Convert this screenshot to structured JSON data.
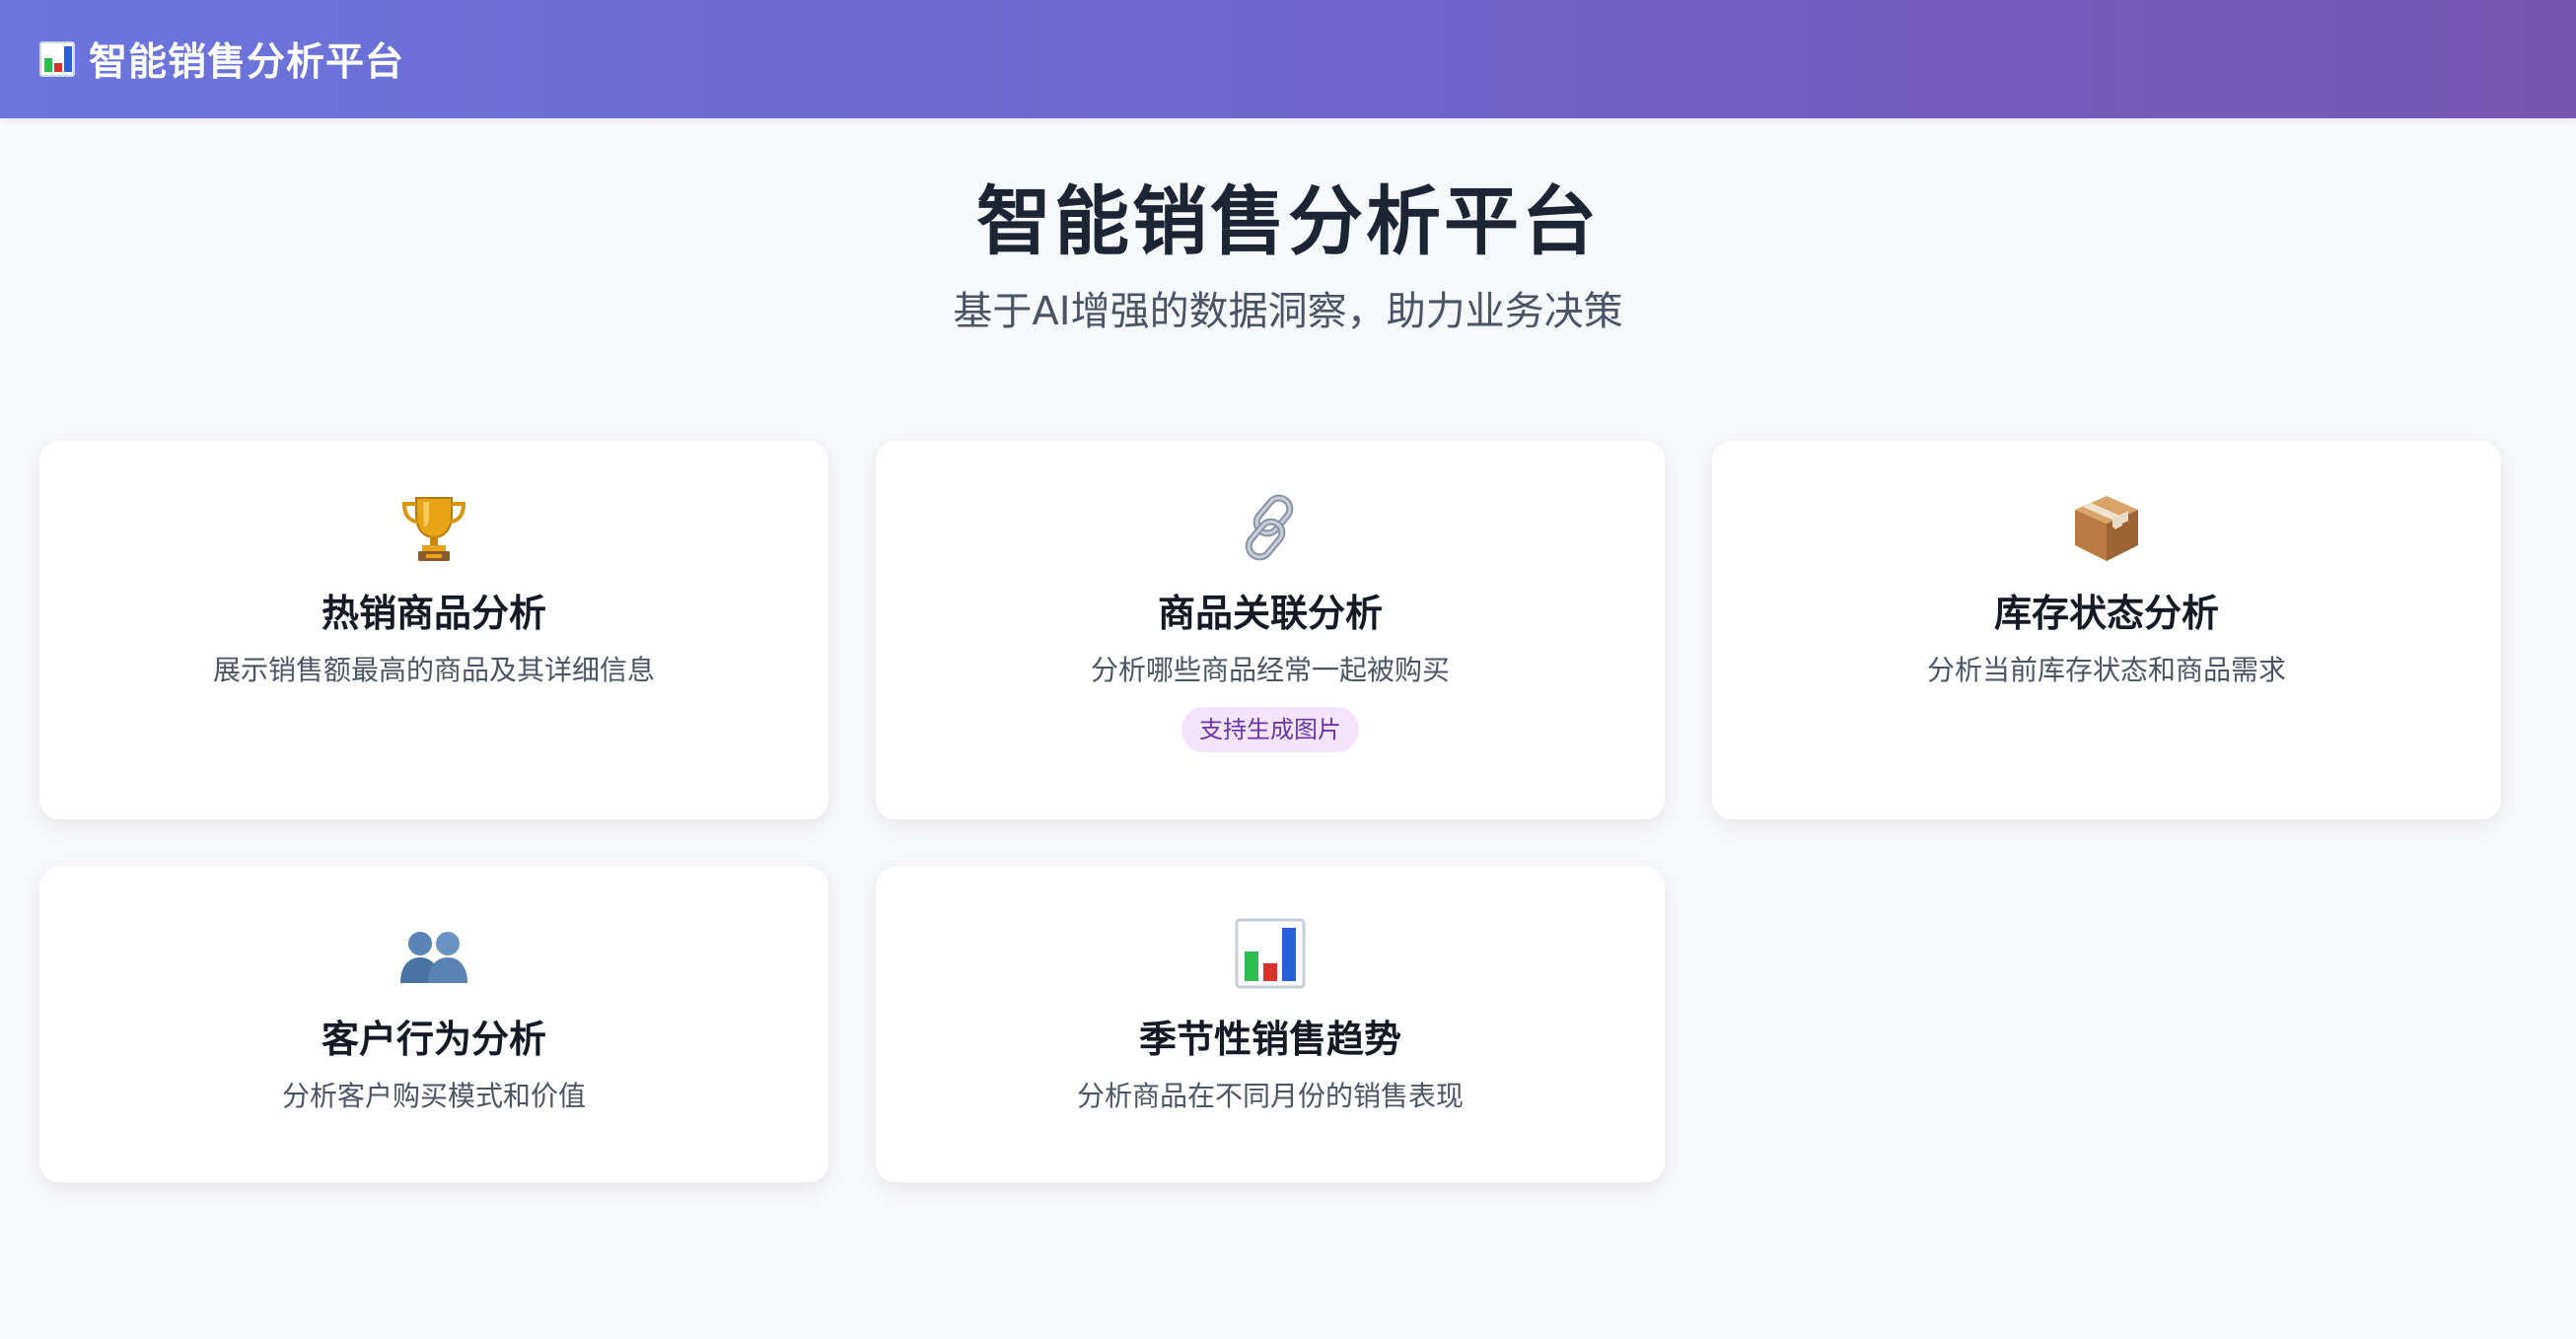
{
  "header": {
    "icon": "bar-chart-icon",
    "title": "智能销售分析平台"
  },
  "hero": {
    "title": "智能销售分析平台",
    "subtitle": "基于AI增强的数据洞察，助力业务决策"
  },
  "cards": [
    {
      "icon": "trophy-icon",
      "title": "热销商品分析",
      "description": "展示销售额最高的商品及其详细信息"
    },
    {
      "icon": "link-icon",
      "title": "商品关联分析",
      "description": "分析哪些商品经常一起被购买",
      "tag": "支持生成图片"
    },
    {
      "icon": "package-icon",
      "title": "库存状态分析",
      "description": "分析当前库存状态和商品需求"
    },
    {
      "icon": "users-icon",
      "title": "客户行为分析",
      "description": "分析客户购买模式和价值"
    },
    {
      "icon": "bar-chart-icon",
      "title": "季节性销售趋势",
      "description": "分析商品在不同月份的销售表现"
    }
  ],
  "colors": {
    "header_gradient_start": "#6a76dc",
    "header_gradient_end": "#7556b4",
    "tag_background": "#f1e4fb",
    "tag_text": "#6f33a8",
    "page_background": "#f7f8fa"
  }
}
